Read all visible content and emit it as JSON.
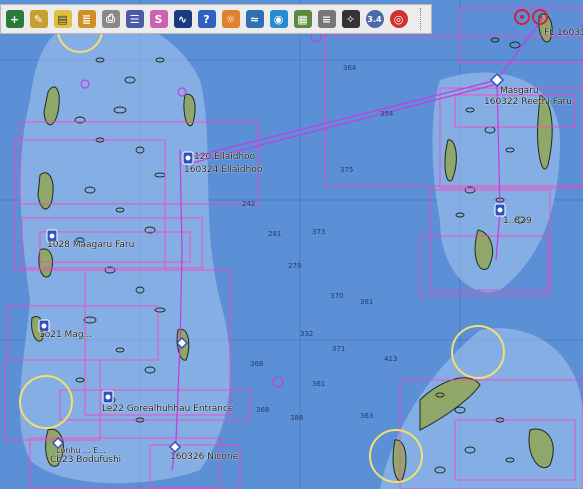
{
  "colors": {
    "sea": "#5b8fd6",
    "shallow": "#a8c8f0",
    "land": "#8fa86a",
    "reef": "#1c2a1c",
    "chart_outline": "#ff40c0",
    "route": "#c040e0",
    "beacon": "#f0e070"
  },
  "toolbar": {
    "buttons": [
      {
        "name": "zoom-in-button",
        "icon": "zoom-in-icon"
      },
      {
        "name": "edit-pencil-button",
        "icon": "pencil-icon"
      },
      {
        "name": "chart-toggle-button",
        "icon": "chart-icon"
      },
      {
        "name": "layers-button",
        "icon": "layers-icon"
      },
      {
        "name": "print-button",
        "icon": "printer-icon"
      },
      {
        "name": "settings-button",
        "icon": "settings-icon"
      },
      {
        "name": "route-button",
        "icon": "route-icon"
      },
      {
        "name": "tide-button",
        "icon": "tide-icon"
      },
      {
        "name": "help-button",
        "icon": "help-icon"
      },
      {
        "name": "grib-button",
        "icon": "weather-icon"
      },
      {
        "name": "ais-button",
        "icon": "waves-icon"
      },
      {
        "name": "globe-button",
        "icon": "globe-icon"
      },
      {
        "name": "dashboard-button",
        "icon": "dashboard-icon"
      },
      {
        "name": "log-button",
        "icon": "notes-icon"
      },
      {
        "name": "compass-button",
        "icon": "compass-icon"
      },
      {
        "name": "scale-button",
        "icon": "scale-icon",
        "label": "3.4"
      },
      {
        "name": "mob-button",
        "icon": "lifebuoy-icon"
      }
    ]
  },
  "chart_labels": [
    {
      "name": "label-ellaidhoo",
      "text": "120 Ellaidhoo"
    },
    {
      "name": "label-ellaidhoo-route",
      "text": "160324 Ellaidhoo"
    },
    {
      "name": "label-maagaru-faru",
      "text": "1028 Maagaru Faru"
    },
    {
      "name": "label-maagaru-2",
      "text": "1o21 Mag..."
    },
    {
      "name": "label-gorealhuhhau",
      "text": "Le22 Gorealhuhhau Entrance"
    },
    {
      "name": "label-bodufushi",
      "text": "Cb23 Bodufushi"
    },
    {
      "name": "label-nicone",
      "text": "160326 Nicone"
    },
    {
      "name": "label-masgaru",
      "text": "Masgaru"
    },
    {
      "name": "label-reethi",
      "text": "160322 Reethi Faru"
    },
    {
      "name": "label-k329",
      "text": "1..329"
    },
    {
      "name": "label-fl1603",
      "text": "FL 16031"
    },
    {
      "name": "label-ehu",
      "text": "Lonhu ... E..."
    }
  ]
}
